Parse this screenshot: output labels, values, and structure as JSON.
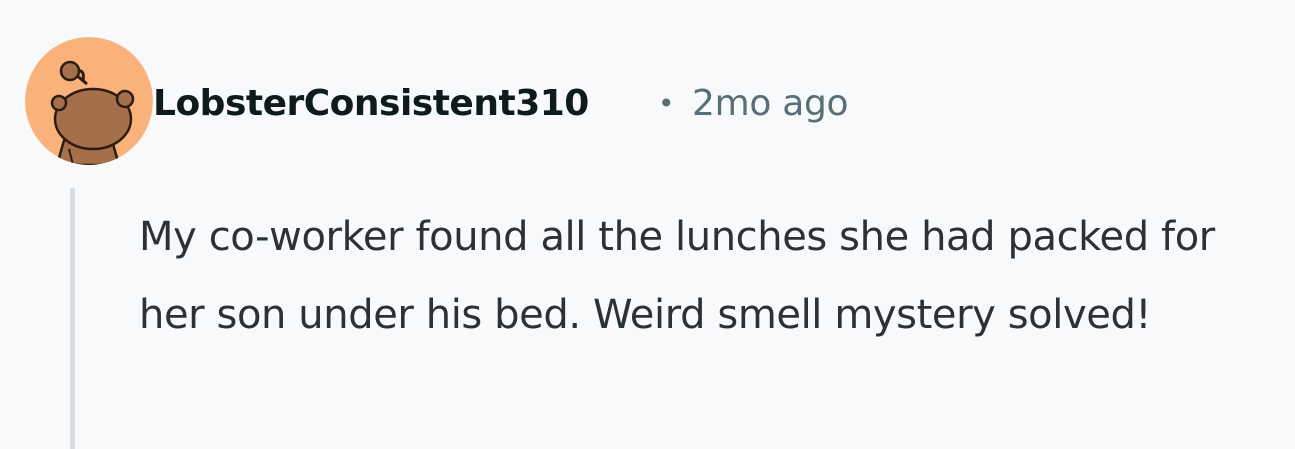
{
  "comment": {
    "author": "LobsterConsistent310",
    "separator": "•",
    "timestamp": "2mo ago",
    "body": "My co-worker found all the lunches she had packed for her son under his bed. Weird smell mystery solved!",
    "avatar_icon": "snoo-avatar-icon"
  },
  "colors": {
    "background": "#f8f9fa",
    "avatar_bg": "#fbb27a",
    "avatar_figure": "#a56f4a",
    "author_text": "#0f1a1c",
    "meta_text": "#576f76",
    "body_text": "#2a3236",
    "thread_line": "#d8dde3"
  }
}
